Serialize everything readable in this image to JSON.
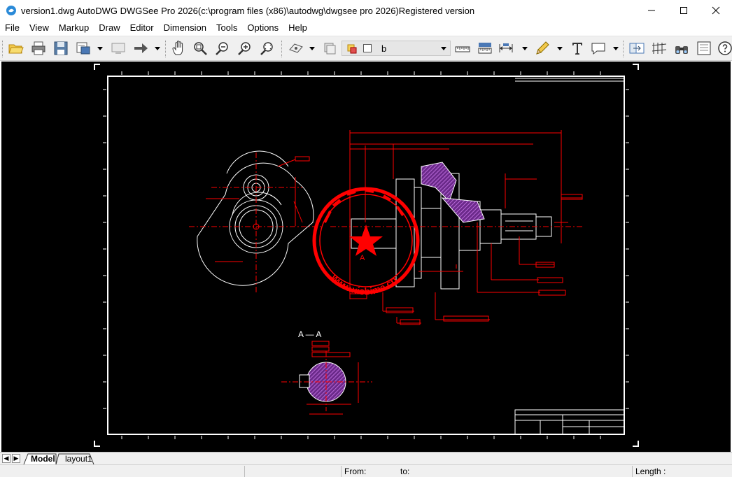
{
  "window": {
    "title": "version1.dwg AutoDWG DWGSee Pro 2026(c:\\program files (x86)\\autodwg\\dwgsee pro 2026)Registered version",
    "controls": [
      "minimize-icon",
      "maximize-icon",
      "close-icon"
    ]
  },
  "menu": {
    "items": [
      "File",
      "View",
      "Markup",
      "Draw",
      "Editor",
      "Dimension",
      "Tools",
      "Options",
      "Help"
    ]
  },
  "toolbar": {
    "icons": [
      "open-folder-icon",
      "print-icon",
      "save-icon",
      "export-icon",
      "screen-icon",
      "forward-arrow-icon",
      "pan-hand-icon",
      "zoom-window-icon",
      "zoom-out-icon",
      "zoom-in-icon",
      "zoom-extents-icon",
      "layer-eye-icon",
      "layer-copy-icon",
      "layer-state-icon",
      "measure-distance-icon",
      "measure-area-icon",
      "dimension-icon",
      "pencil-icon",
      "text-icon",
      "comment-icon",
      "compare-icon",
      "hatch-icon",
      "find-icon",
      "fit-page-icon",
      "help-icon"
    ],
    "layer_name": "b"
  },
  "drawing": {
    "background": "#000000",
    "accent_red": "#ff0000",
    "frame_white": "#ffffff",
    "hatch_purple": "#b05ad8",
    "section_label": "A — A",
    "section_mark": "A",
    "stamp_text": "www.xisbime.cn"
  },
  "tabs": {
    "items": [
      "Model",
      "layout1"
    ],
    "active": "Model"
  },
  "status": {
    "from_label": "From:",
    "to_label": "to:",
    "length_label": "Length :"
  }
}
